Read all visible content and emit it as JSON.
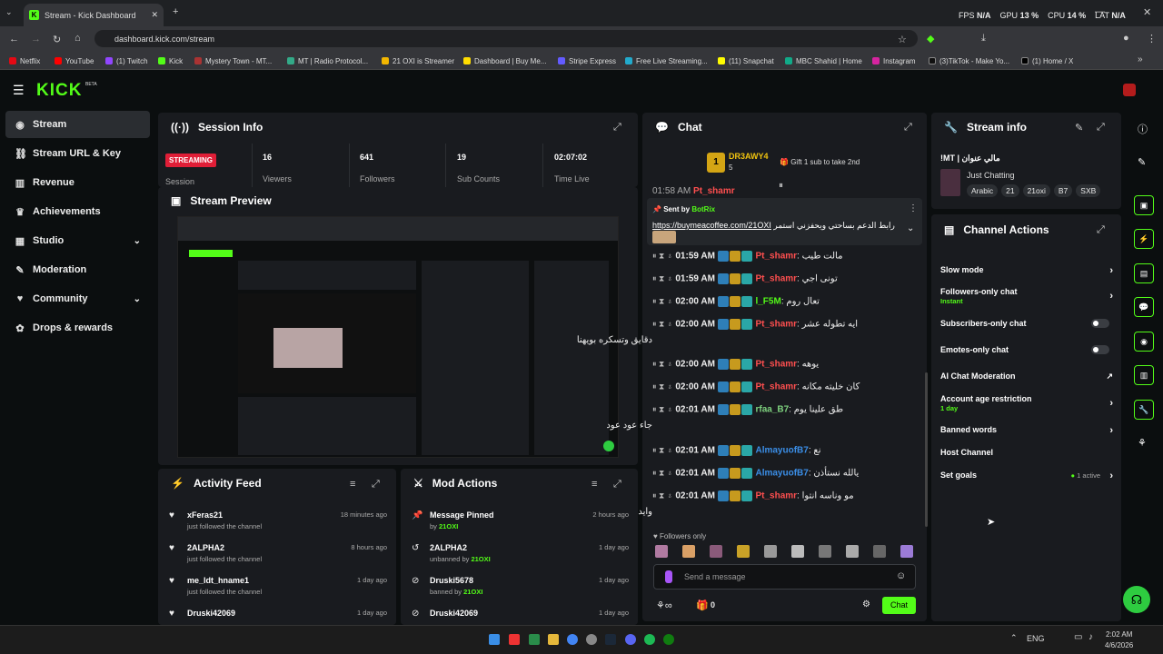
{
  "browser": {
    "tab_title": "Stream - Kick Dashboard",
    "url": "dashboard.kick.com/stream",
    "perf": {
      "fps_label": "FPS",
      "fps_value": "N/A",
      "gpu_label": "GPU",
      "gpu_value": "13 %",
      "cpu_label": "CPU",
      "cpu_value": "14 %",
      "lat_label": "LAT",
      "lat_value": "N/A"
    },
    "bookmarks": [
      "Netflix",
      "YouTube",
      "(1) Twitch",
      "Kick",
      "Mystery Town - MT...",
      "MT | Radio Protocol...",
      "21 OXI is Streamer",
      "Dashboard | Buy Me...",
      "Stripe Express",
      "Free Live Streaming...",
      "(11) Snapchat",
      "MBC Shahid | Home",
      "Instagram",
      "(3)TikTok - Make Yo...",
      "(1) Home / X"
    ]
  },
  "brand": {
    "logo": "KICK",
    "beta": "BETA"
  },
  "sidebar": {
    "items": [
      {
        "label": "Stream",
        "icon": "broadcast-icon"
      },
      {
        "label": "Stream URL & Key",
        "icon": "link-icon"
      },
      {
        "label": "Revenue",
        "icon": "chart-icon"
      },
      {
        "label": "Achievements",
        "icon": "trophy-icon"
      },
      {
        "label": "Studio",
        "icon": "studio-icon"
      },
      {
        "label": "Moderation",
        "icon": "wrench-icon"
      },
      {
        "label": "Community",
        "icon": "community-icon"
      },
      {
        "label": "Drops & rewards",
        "icon": "gift-icon"
      }
    ]
  },
  "session": {
    "title": "Session Info",
    "status": "STREAMING",
    "session_label": "Session",
    "viewers": "16",
    "viewers_label": "Viewers",
    "followers": "641",
    "followers_label": "Followers",
    "subs": "19",
    "subs_label": "Sub Counts",
    "time": "02:07:02",
    "time_label": "Time Live"
  },
  "preview": {
    "title": "Stream Preview"
  },
  "activity": {
    "title": "Activity Feed",
    "items": [
      {
        "name": "xFeras21",
        "sub": "just followed the channel",
        "time": "18 minutes ago"
      },
      {
        "name": "2ALPHA2",
        "sub": "just followed the channel",
        "time": "8 hours ago"
      },
      {
        "name": "me_ldt_hname1",
        "sub": "just followed the channel",
        "time": "1 day ago"
      },
      {
        "name": "Druski42069",
        "sub": "",
        "time": "1 day ago"
      }
    ]
  },
  "mod": {
    "title": "Mod Actions",
    "items": [
      {
        "name": "Message Pinned",
        "by": "by",
        "who": "21OXI",
        "time": "2 hours ago"
      },
      {
        "name": "2ALPHA2",
        "by": "unbanned by",
        "who": "21OXI",
        "time": "1 day ago"
      },
      {
        "name": "Druski5678",
        "by": "banned by",
        "who": "21OXI",
        "time": "1 day ago"
      },
      {
        "name": "Druski42069",
        "by": "",
        "who": "",
        "time": "1 day ago"
      }
    ]
  },
  "chat": {
    "title": "Chat",
    "gifter": {
      "name": "DR3AWY4",
      "rank": "1",
      "count": "5",
      "note": "Gift 1 sub to take 2nd"
    },
    "pinned": {
      "sent_by": "Sent by",
      "who": "BotRix",
      "text": "رابط الدعم بساحتي ويحفزني استمر",
      "link": "https://buymeacoffee.com/21OXI"
    },
    "partial_top": {
      "time": "01:58 AM",
      "name": "Pt_shamr"
    },
    "messages": [
      {
        "time": "01:59 AM",
        "name": "Pt_shamr",
        "color": "#ff4f4f",
        "text": "مالت طيب"
      },
      {
        "time": "01:59 AM",
        "name": "Pt_shamr",
        "color": "#ff4f4f",
        "text": "تونی اجي"
      },
      {
        "time": "02:00 AM",
        "name": "l_F5M",
        "color": "#53fc18",
        "text": "تعال روم"
      },
      {
        "time": "02:00 AM",
        "name": "Pt_shamr",
        "color": "#ff4f4f",
        "text": "ايه تطوله عشر",
        "cont": "دقايق وتسكره بويهنا"
      },
      {
        "time": "02:00 AM",
        "name": "Pt_shamr",
        "color": "#ff4f4f",
        "text": "يوهه"
      },
      {
        "time": "02:00 AM",
        "name": "Pt_shamr",
        "color": "#ff4f4f",
        "text": "كان خليته مكانه"
      },
      {
        "time": "02:01 AM",
        "name": "rfaa_B7",
        "color": "#7fd37f",
        "text": "طق علينا يوم",
        "cont": "جاء عود عود"
      },
      {
        "time": "02:01 AM",
        "name": "AlmayuofB7",
        "color": "#3b8fe8",
        "text": "نع"
      },
      {
        "time": "02:01 AM",
        "name": "AlmayuofB7",
        "color": "#3b8fe8",
        "text": "يالله نستأذن"
      },
      {
        "time": "02:01 AM",
        "name": "Pt_shamr",
        "color": "#ff4f4f",
        "text": "مو وناسه انتوا",
        "cont": "وايد"
      }
    ],
    "followers_only": "Followers only",
    "placeholder": "Send a message",
    "points": "0",
    "chat_button": "Chat"
  },
  "stream_info": {
    "title": "Stream info",
    "stream_title": "!MT | مالي عنوان",
    "category": "Just Chatting",
    "tags": [
      "Arabic",
      "21",
      "21oxi",
      "B7",
      "SXB"
    ]
  },
  "channel_actions": {
    "title": "Channel Actions",
    "items": [
      {
        "label": "Slow mode",
        "sub": "",
        "control": "chevron"
      },
      {
        "label": "Followers-only chat",
        "sub": "Instant",
        "control": "chevron"
      },
      {
        "label": "Subscribers-only chat",
        "sub": "",
        "control": "toggle"
      },
      {
        "label": "Emotes-only chat",
        "sub": "",
        "control": "toggle"
      },
      {
        "label": "AI Chat Moderation",
        "sub": "",
        "control": "external"
      },
      {
        "label": "Account age restriction",
        "sub": "1 day",
        "control": "chevron"
      },
      {
        "label": "Banned words",
        "sub": "",
        "control": "chevron"
      },
      {
        "label": "Host Channel",
        "sub": "",
        "control": "none"
      },
      {
        "label": "Set goals",
        "sub": "",
        "control": "chevron",
        "status": "1 active"
      }
    ]
  },
  "taskbar": {
    "lang": "ENG",
    "time": "2:02 AM",
    "date": "4/6/2026"
  },
  "colors": {
    "accent": "#53fc18",
    "panel": "#191b1f",
    "streaming": "#e01e37"
  }
}
